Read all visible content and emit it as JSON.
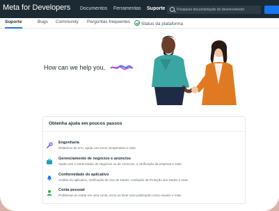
{
  "header": {
    "logo": "Meta for Developers",
    "nav": [
      "Documentos",
      "Ferramentas",
      "Suporte"
    ],
    "active_nav": "Suporte",
    "search_placeholder": "Pesquisar documentação do desenvolvedor",
    "accent": "#1877f2",
    "bar_color": "#1c2b33"
  },
  "tabs": {
    "items": [
      "Suporte",
      "Bugs",
      "Community",
      "Perguntas frequentes",
      "Status da plataforma"
    ],
    "active": "Suporte"
  },
  "hero": {
    "title": "How can we help you,"
  },
  "card": {
    "title": "Obtenha ajuda em poucos passos",
    "items": [
      {
        "title": "Engenharia",
        "desc": "Relatórios de erro, ajuda com erros inesperados e mais",
        "icon": "wrench-icon",
        "color": "#7b61ff"
      },
      {
        "title": "Gerenciamento de negócios e anúncios",
        "desc": "Ajuda com o Gerenciador de Negócios ou de Anúncios, a verificação da empresa e mais",
        "icon": "briefcase-icon",
        "color": "#1aa3b8"
      },
      {
        "title": "Conformidade do aplicativo",
        "desc": "Análise do aplicativo, Verificação de Uso de Dados, Avaliação da Proteção dos Dados e mais",
        "icon": "bell-icon",
        "color": "#1877f2"
      },
      {
        "title": "Conta pessoal",
        "desc": "Problemas ao entrar em uma conta, erros ao fazer uma publicação como usuário e mais",
        "icon": "person-icon",
        "color": "#2bb24c"
      }
    ]
  }
}
